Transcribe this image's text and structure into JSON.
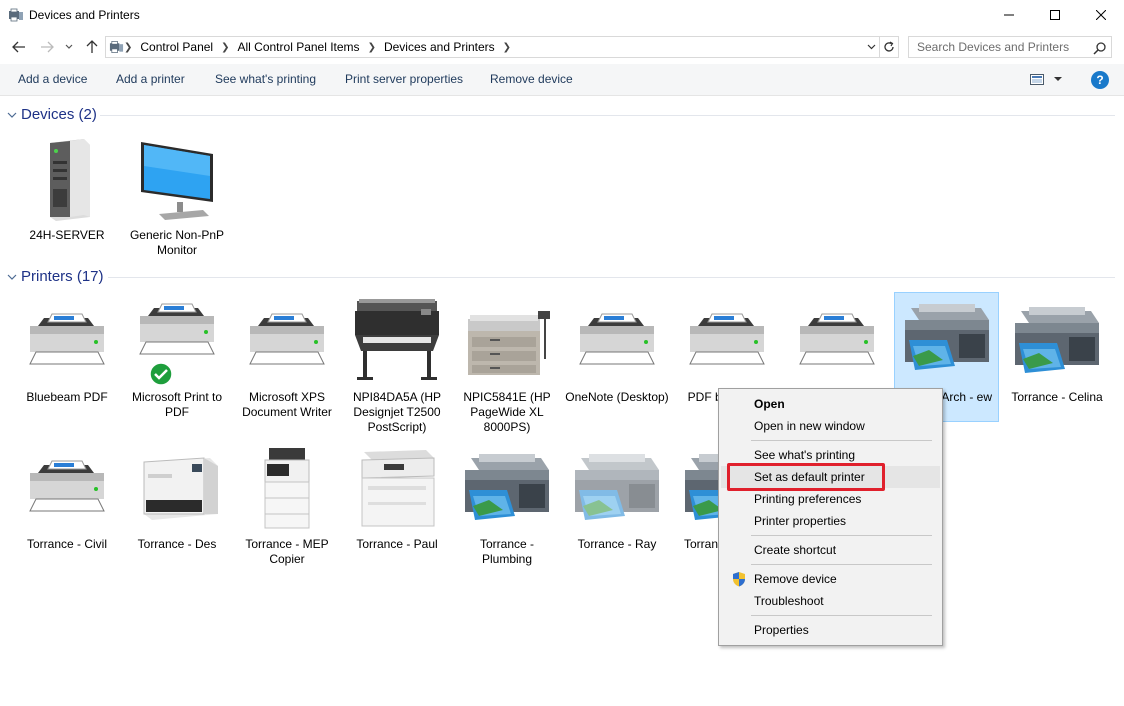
{
  "window": {
    "title": "Devices and Printers"
  },
  "address": {
    "crumbs": [
      "Control Panel",
      "All Control Panel Items",
      "Devices and Printers"
    ]
  },
  "search": {
    "placeholder": "Search Devices and Printers"
  },
  "commands": [
    {
      "label": "Add a device"
    },
    {
      "label": "Add a printer"
    },
    {
      "label": "See what's printing"
    },
    {
      "label": "Print server properties"
    },
    {
      "label": "Remove device"
    }
  ],
  "groups": {
    "devices": {
      "label": "Devices (2)"
    },
    "printers": {
      "label": "Printers (17)"
    }
  },
  "devices": [
    {
      "name": "24H-SERVER",
      "icon": "server-icon"
    },
    {
      "name": "Generic Non-PnP Monitor",
      "icon": "monitor-icon"
    }
  ],
  "printers": [
    {
      "name": "Bluebeam PDF",
      "icon": "printer-icon"
    },
    {
      "name": "Microsoft Print to PDF",
      "icon": "printer-icon",
      "default": true
    },
    {
      "name": "Microsoft XPS Document Writer",
      "icon": "printer-icon"
    },
    {
      "name": "NPI84DA5A (HP Designjet T2500 PostScript)",
      "icon": "plotter-icon"
    },
    {
      "name": "NPIC5841E (HP PageWide XL 8000PS)",
      "icon": "large-format-printer-icon"
    },
    {
      "name": "OneNote (Desktop)",
      "icon": "printer-icon"
    },
    {
      "name": "PDF bi",
      "icon": "printer-icon"
    },
    {
      "name": "",
      "icon": "printer-icon"
    },
    {
      "name": "e - Arch - ew",
      "icon": "multifunction-printer-icon"
    },
    {
      "name": "Torrance - Celina",
      "icon": "multifunction-printer-icon"
    },
    {
      "name": "Torrance - Civil",
      "icon": "printer-icon"
    },
    {
      "name": "Torrance - Des",
      "icon": "color-laser-printer-icon"
    },
    {
      "name": "Torrance - MEP Copier",
      "icon": "copier-icon"
    },
    {
      "name": "Torrance - Paul",
      "icon": "color-mfp-icon"
    },
    {
      "name": "Torrance - Plumbing",
      "icon": "multifunction-printer-icon"
    },
    {
      "name": "Torrance - Ray",
      "icon": "multifunction-printer-icon"
    },
    {
      "name": "Torran",
      "icon": "multifunction-printer-icon"
    }
  ],
  "context_menu": {
    "open": "Open",
    "open_new_window": "Open in new window",
    "see_printing": "See what's printing",
    "set_default": "Set as default printer",
    "printing_prefs": "Printing preferences",
    "printer_props": "Printer properties",
    "create_shortcut": "Create shortcut",
    "remove_device": "Remove device",
    "troubleshoot": "Troubleshoot",
    "properties": "Properties"
  },
  "colors": {
    "link_blue": "#1e3287",
    "selection": "#cce8ff",
    "highlight_red": "#e0202c",
    "check_green": "#1e9e3c"
  }
}
